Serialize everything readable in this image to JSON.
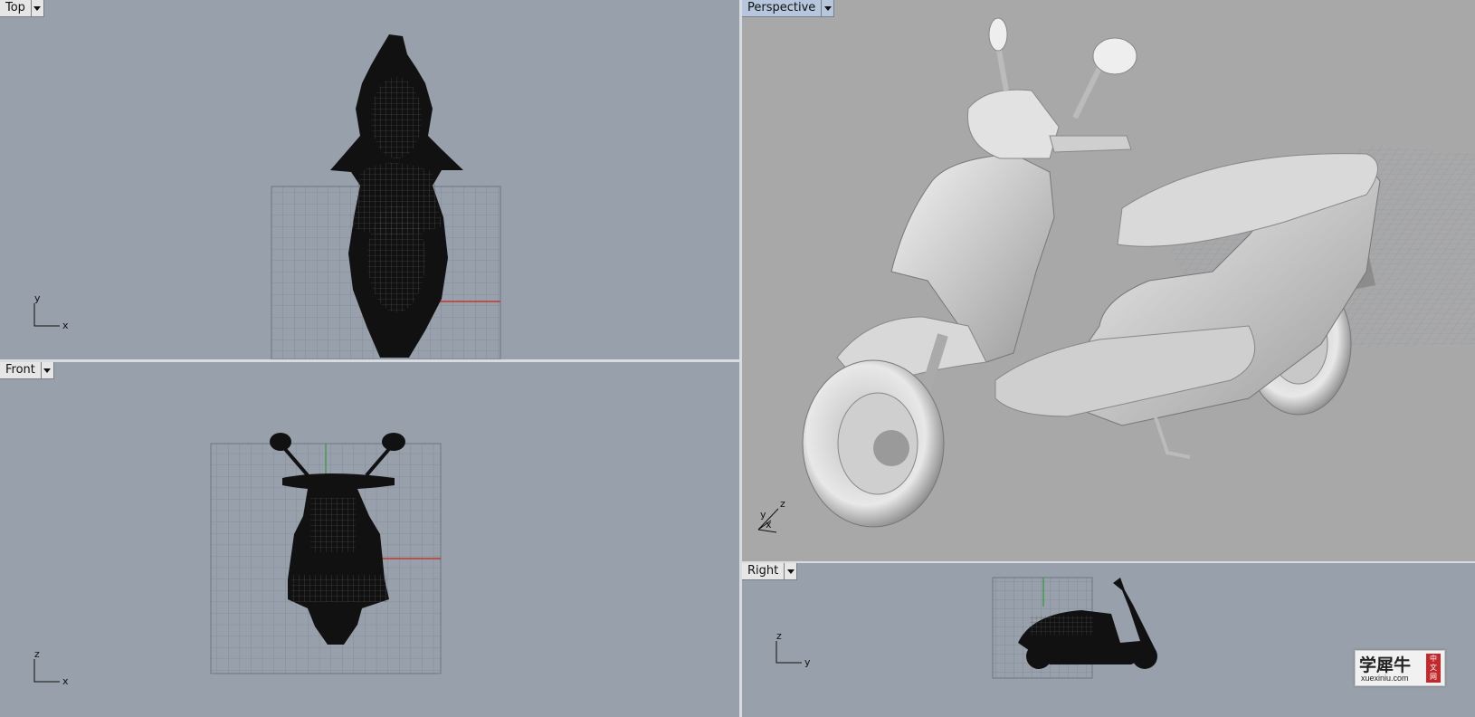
{
  "viewports": {
    "top": {
      "label": "Top",
      "axis_h": "x",
      "axis_v": "y"
    },
    "front": {
      "label": "Front",
      "axis_h": "x",
      "axis_v": "z"
    },
    "perspective": {
      "label": "Perspective",
      "axis_z": "z",
      "axis_x": "x",
      "axis_y": "y"
    },
    "right": {
      "label": "Right",
      "axis_h": "y",
      "axis_v": "z"
    }
  },
  "watermark": {
    "title": "学犀牛",
    "url": "xuexiniu.com",
    "seal": [
      "中",
      "文",
      "网"
    ]
  },
  "colors": {
    "viewport_bg": "#98a1ab",
    "perspective_bg": "#a8a8a8",
    "active_tab": "#b6c6dc",
    "x_axis": "#c0392b",
    "y_axis": "#2e9a3a"
  }
}
